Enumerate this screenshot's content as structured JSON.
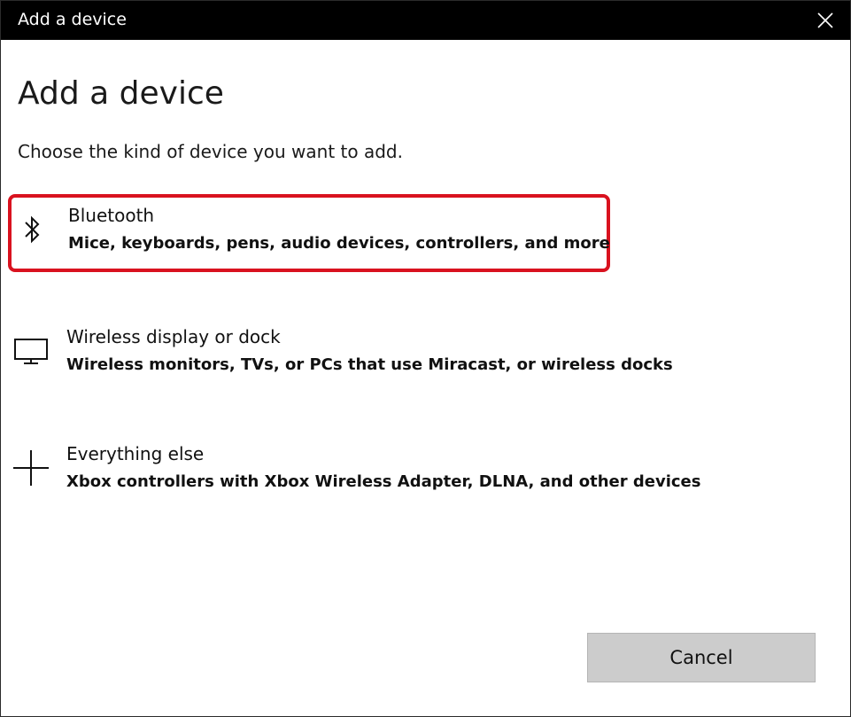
{
  "window": {
    "title": "Add a device"
  },
  "main": {
    "heading": "Add a device",
    "subheading": "Choose the kind of device you want to add."
  },
  "options": [
    {
      "title": "Bluetooth",
      "description": "Mice, keyboards, pens, audio devices, controllers, and more",
      "icon": "bluetooth-icon",
      "highlighted": true
    },
    {
      "title": "Wireless display or dock",
      "description": "Wireless monitors, TVs, or PCs that use Miracast, or wireless docks",
      "icon": "monitor-icon",
      "highlighted": false
    },
    {
      "title": "Everything else",
      "description": "Xbox controllers with Xbox Wireless Adapter, DLNA, and other devices",
      "icon": "plus-icon",
      "highlighted": false
    }
  ],
  "footer": {
    "cancel_label": "Cancel"
  },
  "colors": {
    "titlebar": "#000000",
    "highlight_border": "#d9121f",
    "button_bg": "#cccccc"
  }
}
